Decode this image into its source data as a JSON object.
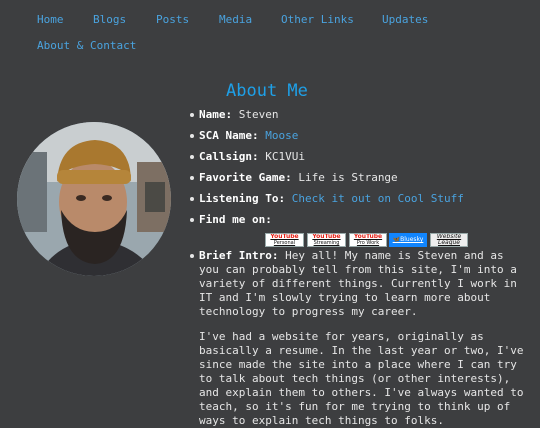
{
  "nav": {
    "items": [
      "Home",
      "Blogs",
      "Posts",
      "Media",
      "Other Links",
      "Updates",
      "About & Contact"
    ]
  },
  "page_title": "About Me",
  "info": {
    "name_label": "Name:",
    "name_value": "Steven",
    "sca_label": "SCA Name:",
    "sca_value": "Moose",
    "callsign_label": "Callsign:",
    "callsign_value": "KC1VUi",
    "game_label": "Favorite Game:",
    "game_value": "Life is Strange",
    "listening_label": "Listening To:",
    "listening_value": "Check it out on Cool Stuff",
    "findme_label": "Find me on:"
  },
  "badges": [
    {
      "brand": "YouTube",
      "label": "Personal",
      "icon": "youtube-icon"
    },
    {
      "brand": "YouTube",
      "label": "Streaming",
      "icon": "youtube-icon"
    },
    {
      "brand": "YouTube",
      "label": "Pro Work",
      "icon": "youtube-icon"
    },
    {
      "brand": "Bluesky",
      "label": "Bluesky",
      "icon": "butterfly-icon"
    },
    {
      "brand": "Website League",
      "label": "Website League",
      "icon": "website-league-icon"
    }
  ],
  "intro": {
    "label": "Brief Intro:",
    "p1": " Hey all! My name is Steven and as you can probably tell from this site, I'm into a variety of different things. Currently I work in IT and I'm slowly trying to learn more about technology to progress my career.",
    "p2": "I've had a website for years, originally as basically a resume. In the last year or two, I've since made the site into a place where I can try to talk about tech things (or other interests), and explain them to others. I've always wanted to teach, so it's fun for me trying to think up of ways to explain tech things to folks."
  },
  "colors": {
    "background": "#3d3e40",
    "link": "#4aa3df",
    "title": "#1ea0e8"
  }
}
